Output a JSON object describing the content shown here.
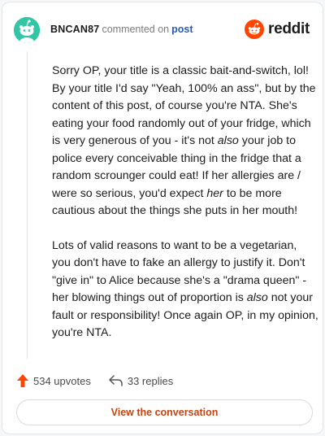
{
  "header": {
    "username": "BNCAN87",
    "action": "commented on",
    "post_link": "post",
    "logo_text": "reddit"
  },
  "comment": {
    "p1": {
      "a": "Sorry OP, your title is a classic bait-and-switch, lol! By your title I'd say \"Yeah, 100% an ass\", but by the content of this post, of course you're NTA. She's eating your food randomly out of your fridge, which is very generous of you - it's not ",
      "b": "also",
      "c": " your job to police every conceivable thing in the fridge that a random scrounger could eat! If her allergies are / were so serious, you'd expect ",
      "d": "her",
      "e": " to be more cautious about the things she puts in her mouth!"
    },
    "p2": {
      "a": "Lots of valid reasons to want to be a vegetarian, you don't have to fake an allergy to justify it. Don't \"give in\" to Alice because she's a \"drama queen\" - her blowing things out of proportion is ",
      "b": "also",
      "c": " not your fault or responsibility! Once again OP, in my opinion, you're NTA."
    }
  },
  "footer": {
    "upvotes": "534 upvotes",
    "replies": "33 replies",
    "view_button": "View the conversation"
  },
  "colors": {
    "accent": "#ff4500",
    "link": "#2a5db0",
    "button_text": "#c4430f",
    "avatar_bg": "#33c6a6"
  },
  "icons": {
    "avatar": "snoo-avatar",
    "logo": "reddit-snoo-logo",
    "upvote": "upvote-arrow-icon",
    "reply": "reply-arrow-icon"
  }
}
